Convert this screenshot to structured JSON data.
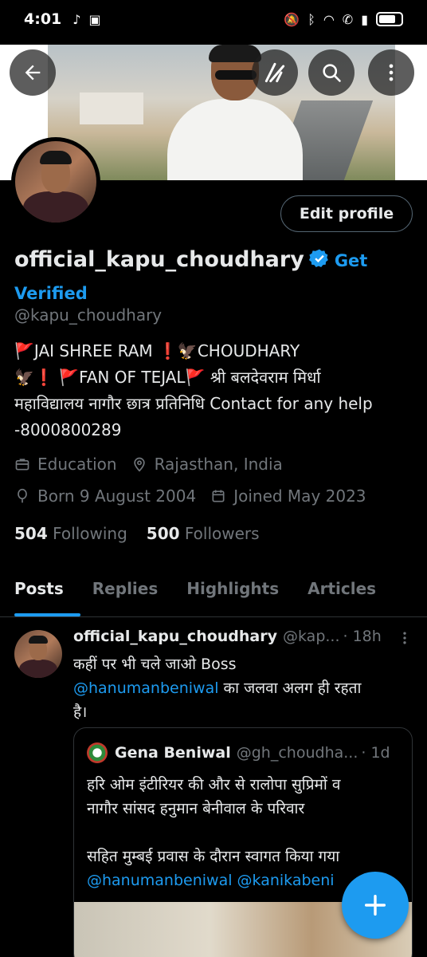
{
  "status_bar": {
    "time": "4:01"
  },
  "profile": {
    "display_name": "official_kapu_choudhary",
    "get_verified": "Get Verified",
    "handle": "@kapu_choudhary",
    "bio_line1": "JAI SHREE RAM ❗🦅CHOUDHARY",
    "bio_line2": "❗ ",
    "bio_line2b": "FAN OF TEJAL",
    "bio_line2c": " श्री बलदेवराम मिर्धा",
    "bio_line3": "महाविद्यालय नागौर छात्र प्रतिनिधि Contact for any help",
    "bio_line4": "-8000800289",
    "category": "Education",
    "location": "Rajasthan, India",
    "birth": "Born 9 August 2004",
    "joined": "Joined May 2023",
    "following_count": "504",
    "following_label": "Following",
    "followers_count": "500",
    "followers_label": "Followers",
    "edit_label": "Edit profile"
  },
  "tabs": [
    "Posts",
    "Replies",
    "Highlights",
    "Articles"
  ],
  "post": {
    "author": "official_kapu_choudhary",
    "handle": "@kap...",
    "time": "· 18h",
    "text_line1": "कहीं पर भी चले जाओ Boss",
    "mention": "@hanumanbeniwal",
    "text_line2_rest": " का जलवा अलग ही रहता",
    "text_line3": "है।",
    "quote": {
      "author": "Gena Beniwal",
      "handle": "@gh_choudha...",
      "time": "· 1d",
      "line1": "हरि ओम इंटीरियर की और से रालोपा सुप्रिमों व",
      "line2": "नागौर सांसद  हनुमान बेनीवाल के परिवार",
      "line3": "सहित मुम्बई प्रवास के दौरान स्वागत किया गया",
      "line4": "@hanumanbeniwal @kanikabeni"
    }
  }
}
